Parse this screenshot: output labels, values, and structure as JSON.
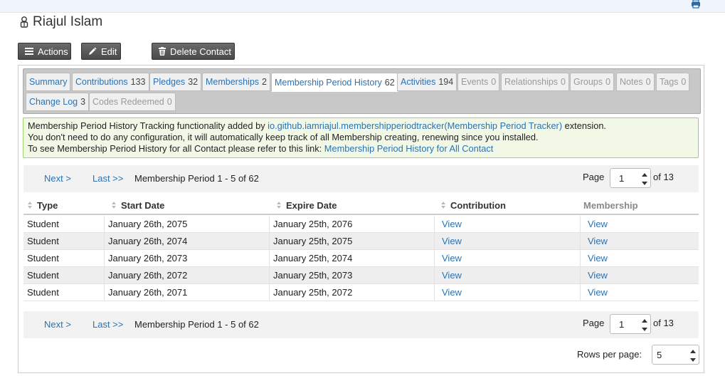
{
  "contact": {
    "name": "Riajul Islam"
  },
  "actions": {
    "actions_label": "Actions",
    "edit_label": "Edit",
    "delete_label": "Delete Contact"
  },
  "tabs": [
    {
      "label": "Summary",
      "count": ""
    },
    {
      "label": "Contributions",
      "count": "133"
    },
    {
      "label": "Pledges",
      "count": "32"
    },
    {
      "label": "Memberships",
      "count": "2"
    },
    {
      "label": "Membership Period History",
      "count": "62"
    },
    {
      "label": "Activities",
      "count": "194"
    },
    {
      "label": "Events",
      "count": "0"
    },
    {
      "label": "Relationships",
      "count": "0"
    },
    {
      "label": "Groups",
      "count": "0"
    },
    {
      "label": "Notes",
      "count": "0"
    },
    {
      "label": "Tags",
      "count": "0"
    },
    {
      "label": "Change Log",
      "count": "3"
    },
    {
      "label": "Codes Redeemed",
      "count": "0"
    }
  ],
  "notice": {
    "line1_prefix": "Membership Period History Tracking functionality added by ",
    "line1_link": "io.github.iamriajul.membershipperiodtracker(Membership Period Tracker)",
    "line1_suffix": " extension.",
    "line2": "You don't need to do any configuration, it will automatically keep track of all Membership creating, renewing since you installed.",
    "line3_prefix": "To see Membership Period History for all Contact please refer to this link: ",
    "line3_link": "Membership Period History for All Contact"
  },
  "pager": {
    "next": "Next >",
    "last": "Last >>",
    "range": "Membership Period 1 - 5 of 62",
    "page_label": "Page",
    "page_value": "1",
    "of_label": "of 13"
  },
  "table": {
    "headers": [
      "Type",
      "Start Date",
      "Expire Date",
      "Contribution",
      "Membership"
    ],
    "rows": [
      {
        "type": "Student",
        "start": "January 26th, 2075",
        "expire": "January 25th, 2076",
        "contribution": "View",
        "membership": "View"
      },
      {
        "type": "Student",
        "start": "January 26th, 2074",
        "expire": "January 25th, 2075",
        "contribution": "View",
        "membership": "View"
      },
      {
        "type": "Student",
        "start": "January 26th, 2073",
        "expire": "January 25th, 2074",
        "contribution": "View",
        "membership": "View"
      },
      {
        "type": "Student",
        "start": "January 26th, 2072",
        "expire": "January 25th, 2073",
        "contribution": "View",
        "membership": "View"
      },
      {
        "type": "Student",
        "start": "January 26th, 2071",
        "expire": "January 25th, 2072",
        "contribution": "View",
        "membership": "View"
      }
    ]
  },
  "rows_per_page": {
    "label": "Rows per page:",
    "value": "5"
  }
}
